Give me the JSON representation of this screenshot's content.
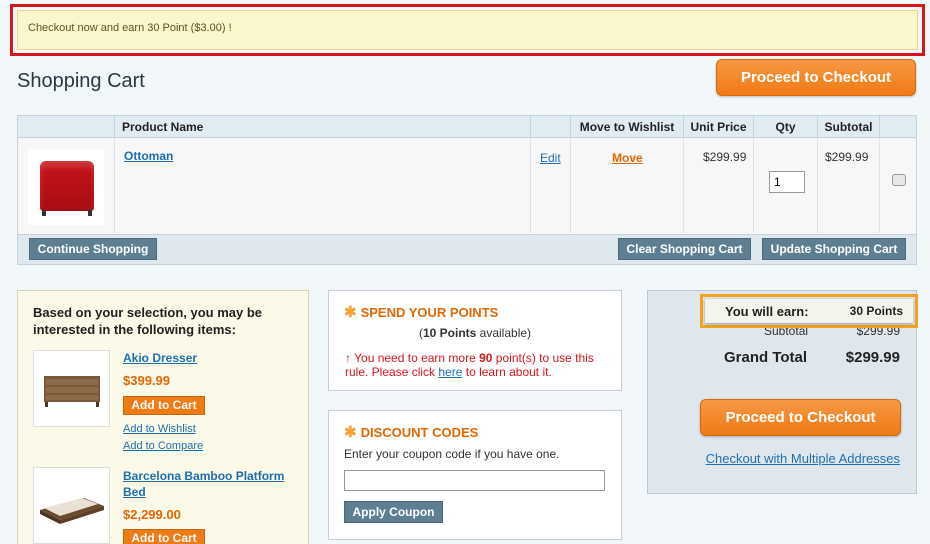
{
  "notice": "Checkout now and earn 30 Point ($3.00) !",
  "page_title": "Shopping Cart",
  "checkout_button": "Proceed to Checkout",
  "cart": {
    "headers": {
      "product_name": "Product Name",
      "move_to_wishlist": "Move to Wishlist",
      "unit_price": "Unit Price",
      "qty": "Qty",
      "subtotal": "Subtotal"
    },
    "item": {
      "name": "Ottoman",
      "edit": "Edit",
      "move": "Move",
      "unit_price": "$299.99",
      "qty": "1",
      "subtotal": "$299.99"
    },
    "continue_shopping": "Continue Shopping",
    "clear_cart": "Clear Shopping Cart",
    "update_cart": "Update Shopping Cart"
  },
  "crosssell": {
    "heading": "Based on your selection, you may be interested in the following items:",
    "items": [
      {
        "name": "Akio Dresser",
        "price": "$399.99",
        "add_to_cart": "Add to Cart",
        "add_to_wishlist": "Add to Wishlist",
        "add_to_compare": "Add to Compare"
      },
      {
        "name": "Barcelona Bamboo Platform Bed",
        "price": "$2,299.00",
        "add_to_cart": "Add to Cart"
      }
    ]
  },
  "points": {
    "title": "SPEND YOUR POINTS",
    "available_count": "10 Points",
    "available_suffix": " available)",
    "available_prefix": "(",
    "msg_prefix": "You need to earn more ",
    "msg_number": "90",
    "msg_middle": " point(s) to use this rule. Please click ",
    "msg_link": "here",
    "msg_suffix": " to learn about it."
  },
  "discount": {
    "title": "DISCOUNT CODES",
    "label": "Enter your coupon code if you have one.",
    "input_value": "",
    "apply": "Apply Coupon"
  },
  "totals": {
    "earn_label": "You will earn:",
    "earn_value": "30 Points",
    "subtotal_label": "Subtotal",
    "subtotal_value": "$299.99",
    "grand_total_label": "Grand Total",
    "grand_total_value": "$299.99",
    "multi_address": "Checkout with Multiple Addresses"
  },
  "colors": {
    "accent_orange": "#f07a14",
    "notice_border": "#d8141c",
    "highlight_border": "#f2a320",
    "link_blue": "#1e6fb0"
  }
}
